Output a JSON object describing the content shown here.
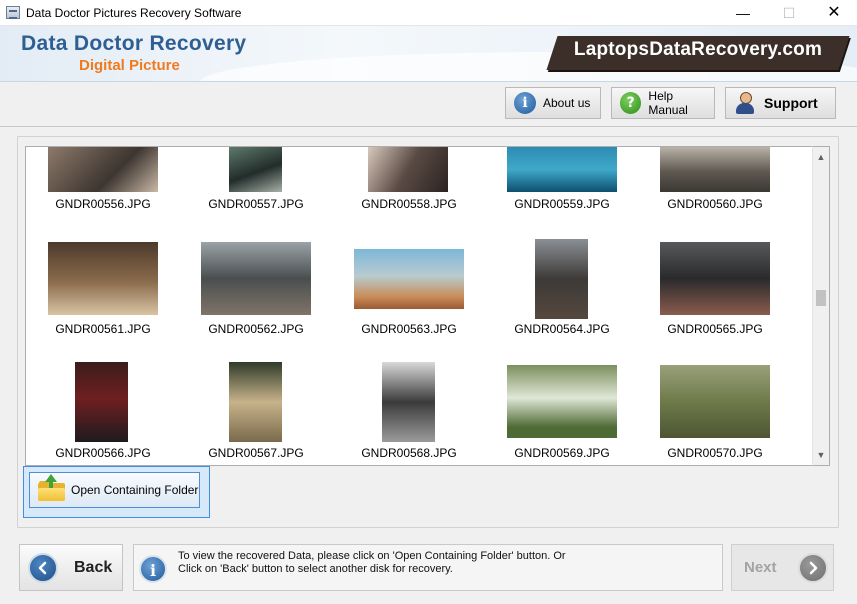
{
  "window": {
    "title": "Data Doctor Pictures Recovery Software",
    "minimize": "—",
    "maximize": "☐",
    "close": "✕"
  },
  "header": {
    "brand_main": "Data Doctor Recovery",
    "brand_sub": "Digital Picture",
    "site": "LaptopsDataRecovery.com"
  },
  "toolbar": {
    "about": "About us",
    "help": "Help Manual",
    "support": "Support"
  },
  "gallery": {
    "files": [
      "GNDR00556.JPG",
      "GNDR00557.JPG",
      "GNDR00558.JPG",
      "GNDR00559.JPG",
      "GNDR00560.JPG",
      "GNDR00561.JPG",
      "GNDR00562.JPG",
      "GNDR00563.JPG",
      "GNDR00564.JPG",
      "GNDR00565.JPG",
      "GNDR00566.JPG",
      "GNDR00567.JPG",
      "GNDR00568.JPG",
      "GNDR00569.JPG",
      "GNDR00570.JPG"
    ]
  },
  "actions": {
    "open_folder": "Open Containing Folder"
  },
  "footer": {
    "back": "Back",
    "info_line1": "To view the recovered Data, please click on 'Open Containing Folder' button. Or",
    "info_line2": "Click on 'Back' button to select another disk for recovery.",
    "next": "Next"
  }
}
